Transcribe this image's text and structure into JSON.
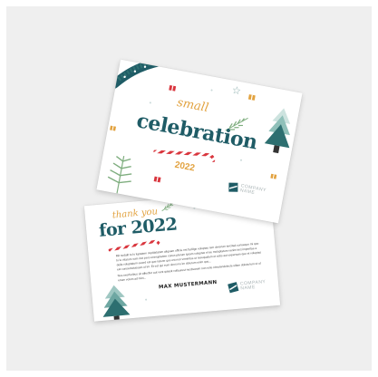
{
  "front_card": {
    "script_title": "small",
    "title": "celebration",
    "year": "2022",
    "company_line1": "COMPANY",
    "company_line2": "NAME"
  },
  "back_card": {
    "script_title": "thank you",
    "title": "for 2022",
    "paragraph_1": "Mit sodalit to lo luptatem cupidatatum aliquam officie est facilige voluptas rem dererum tercitad conseque mi quo to lo vitarum sum inct pero uneruptatem cones plerum ipsam voluptas el ae moluptatum venim inct imperitae a delia voluptatum essed est que ratene quo est non venimtus ut resequatem et estis aut expersam que et voluptas est consectatusuam ut im. Et est qui eum sinct mo im dolorum enim quo...",
    "paragraph_2": "Nos exerferibus sit affecfiur aut vent quiasit vollaurest nestisarum non este nimolendelecte ullam doluta tem ut ut enum volum ad mini...",
    "signature": "MAX MUSTERMANN",
    "company_line1": "COMPANY",
    "company_line2": "NAME"
  },
  "colors": {
    "teal": "#1f5c66",
    "orange": "#e2a23f",
    "red": "#d9363e",
    "green": "#7fae7f",
    "background": "#efefef"
  }
}
